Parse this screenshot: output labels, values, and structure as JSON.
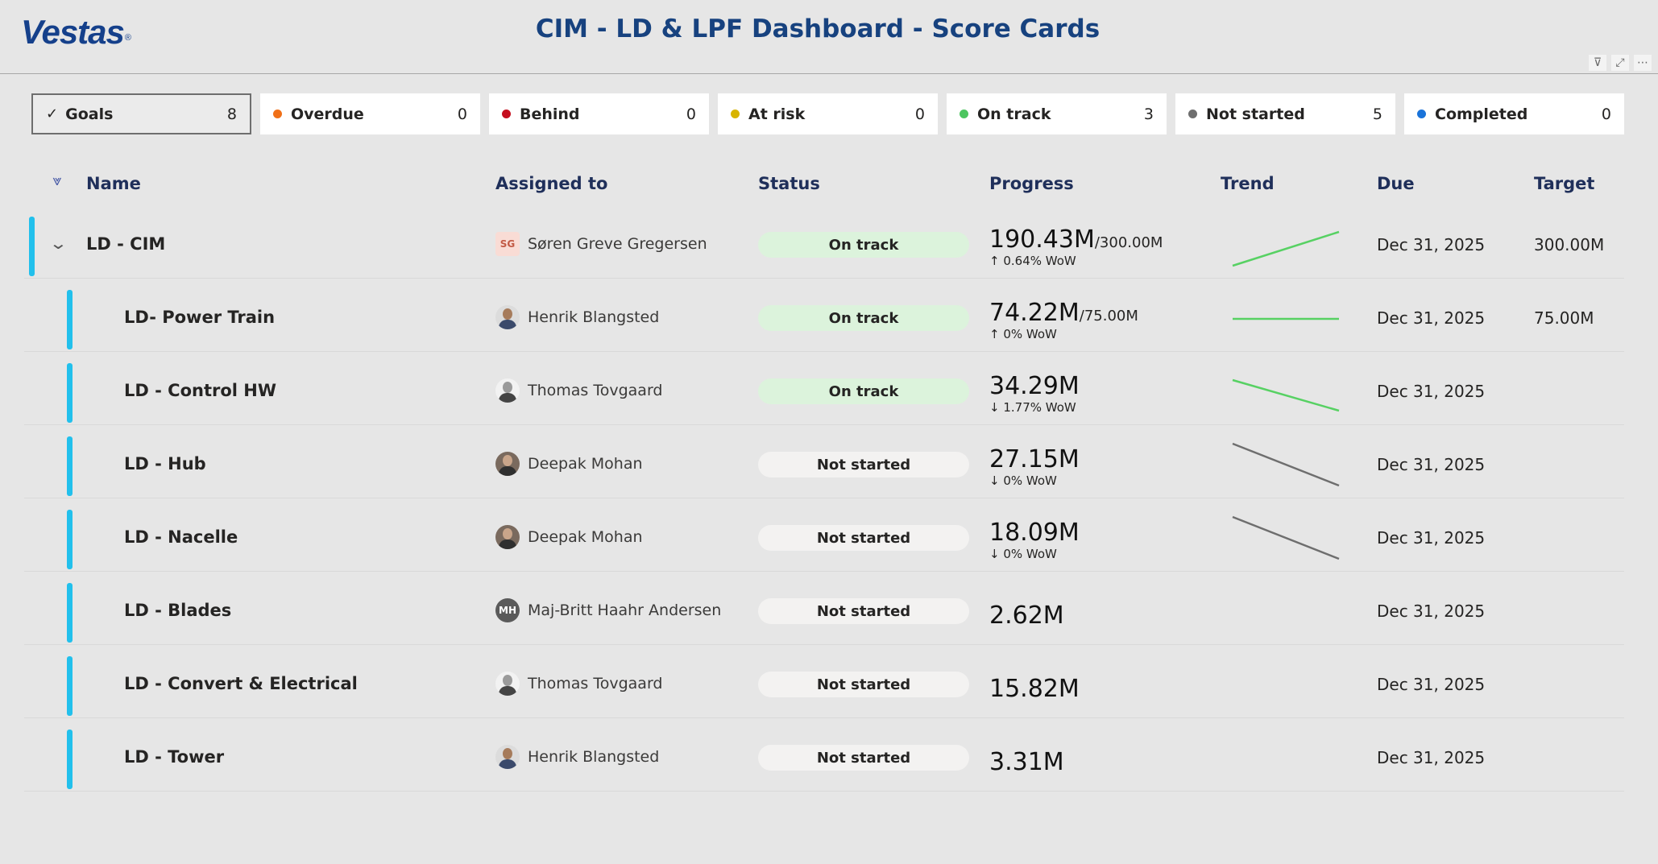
{
  "header": {
    "logo_text": "Vestas",
    "logo_mark": "®",
    "title": "CIM - LD & LPF Dashboard - Score Cards",
    "icons": [
      "filter-icon",
      "focus-mode-icon",
      "more-options-icon"
    ]
  },
  "filters": [
    {
      "label": "Goals",
      "count": "8",
      "color": "",
      "selected": true
    },
    {
      "label": "Overdue",
      "count": "0",
      "color": "#f07018"
    },
    {
      "label": "Behind",
      "count": "0",
      "color": "#c50f1f"
    },
    {
      "label": "At risk",
      "count": "0",
      "color": "#d8b400"
    },
    {
      "label": "On track",
      "count": "3",
      "color": "#4cc55f"
    },
    {
      "label": "Not started",
      "count": "5",
      "color": "#6e6e6e"
    },
    {
      "label": "Completed",
      "count": "0",
      "color": "#1a73d9"
    }
  ],
  "columns": {
    "name": "Name",
    "assigned_to": "Assigned to",
    "status": "Status",
    "progress": "Progress",
    "trend": "Trend",
    "due": "Due",
    "target": "Target"
  },
  "colors": {
    "accent_bar": "#22c0ec",
    "on_track_pill": "#dcf3dc",
    "not_started_pill": "#f3f2f1",
    "trend_green": "#57d163",
    "trend_grey": "#6e6e6e"
  },
  "goals": [
    {
      "name": "LD - CIM",
      "assignee": "Søren Greve Gregersen",
      "avatar": "SG",
      "status": "On track",
      "current": "190.43M",
      "of_target": "/300.00M",
      "wow": "↑ 0.64% WoW",
      "trend": "up",
      "due": "Dec 31, 2025",
      "target": "300.00M"
    },
    {
      "name": "LD- Power Train",
      "assignee": "Henrik Blangsted",
      "avatar": "",
      "status": "On track",
      "current": "74.22M",
      "of_target": "/75.00M",
      "wow": "↑ 0% WoW",
      "trend": "flat",
      "due": "Dec 31, 2025",
      "target": "75.00M"
    },
    {
      "name": "LD - Control HW",
      "assignee": "Thomas Tovgaard",
      "avatar": "",
      "status": "On track",
      "current": "34.29M",
      "of_target": "",
      "wow": "↓ 1.77% WoW",
      "trend": "down",
      "due": "Dec 31, 2025",
      "target": ""
    },
    {
      "name": "LD - Hub",
      "assignee": "Deepak Mohan",
      "avatar": "",
      "status": "Not started",
      "current": "27.15M",
      "of_target": "",
      "wow": "↓ 0% WoW",
      "trend": "down",
      "due": "Dec 31, 2025",
      "target": ""
    },
    {
      "name": "LD - Nacelle",
      "assignee": "Deepak Mohan",
      "avatar": "",
      "status": "Not started",
      "current": "18.09M",
      "of_target": "",
      "wow": "↓ 0% WoW",
      "trend": "down",
      "due": "Dec 31, 2025",
      "target": ""
    },
    {
      "name": "LD - Blades",
      "assignee": "Maj-Britt Haahr Andersen",
      "avatar": "MH",
      "status": "Not started",
      "current": "2.62M",
      "of_target": "",
      "wow": "",
      "trend": "",
      "due": "Dec 31, 2025",
      "target": ""
    },
    {
      "name": "LD - Convert & Electrical",
      "assignee": "Thomas Tovgaard",
      "avatar": "",
      "status": "Not started",
      "current": "15.82M",
      "of_target": "",
      "wow": "",
      "trend": "",
      "due": "Dec 31, 2025",
      "target": ""
    },
    {
      "name": "LD - Tower",
      "assignee": "Henrik Blangsted",
      "avatar": "",
      "status": "Not started",
      "current": "3.31M",
      "of_target": "",
      "wow": "",
      "trend": "",
      "due": "Dec 31, 2025",
      "target": ""
    }
  ]
}
